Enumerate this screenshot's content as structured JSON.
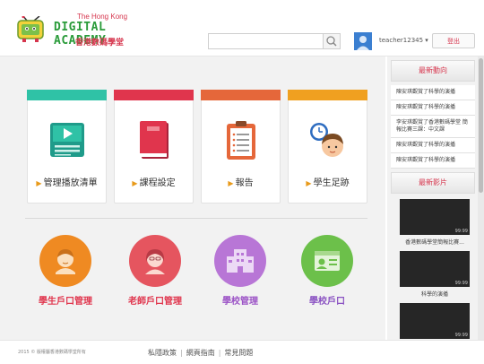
{
  "header": {
    "logo_line1": "The Hong Kong",
    "logo_line2": "DIGITAL ACADEMY",
    "logo_line3": "香港數碼學堂",
    "search_placeholder": "",
    "username": "teacher12345 ▾",
    "logout_label": "登出"
  },
  "cards": [
    {
      "label": "管理播放清單",
      "color": "#2fc2a6",
      "icon": "video-playlist-icon"
    },
    {
      "label": "課程設定",
      "color": "#e0354d",
      "icon": "book-icon"
    },
    {
      "label": "報告",
      "color": "#e5673a",
      "icon": "clipboard-icon"
    },
    {
      "label": "學生足跡",
      "color": "#f0a020",
      "icon": "student-clock-icon"
    }
  ],
  "circles": [
    {
      "label": "學生戶口管理",
      "color": "#ef8a22",
      "label_color": "#e0354d"
    },
    {
      "label": "老師戶口管理",
      "color": "#e5555f",
      "label_color": "#e0354d"
    },
    {
      "label": "學校管理",
      "color": "#b876d6",
      "label_color": "#9b52c6"
    },
    {
      "label": "學校戶口",
      "color": "#6cc04a",
      "label_color": "#8a52c2"
    }
  ],
  "sidebar": {
    "news_title": "最新動向",
    "news": [
      "陳安琪觀賞了科學的演播",
      "陳安琪觀賞了科學的演播",
      "李安琪觀賞了香港數碼學堂 簡報比賽三課：中文課",
      "陳安琪觀賞了科學的演播",
      "陳安琪觀賞了科學的演播"
    ],
    "videos_title": "最新影片",
    "videos": [
      {
        "duration": "99:99",
        "caption": "香港數碼學堂簡報比賽..."
      },
      {
        "duration": "99:99",
        "caption": "科學的演播"
      },
      {
        "duration": "99:99",
        "caption": ""
      }
    ]
  },
  "footer": {
    "copyright": "2015 © 版權屬香港數碼學堂所有",
    "links": [
      "私隱政策",
      "網頁指南",
      "常見問題"
    ]
  }
}
